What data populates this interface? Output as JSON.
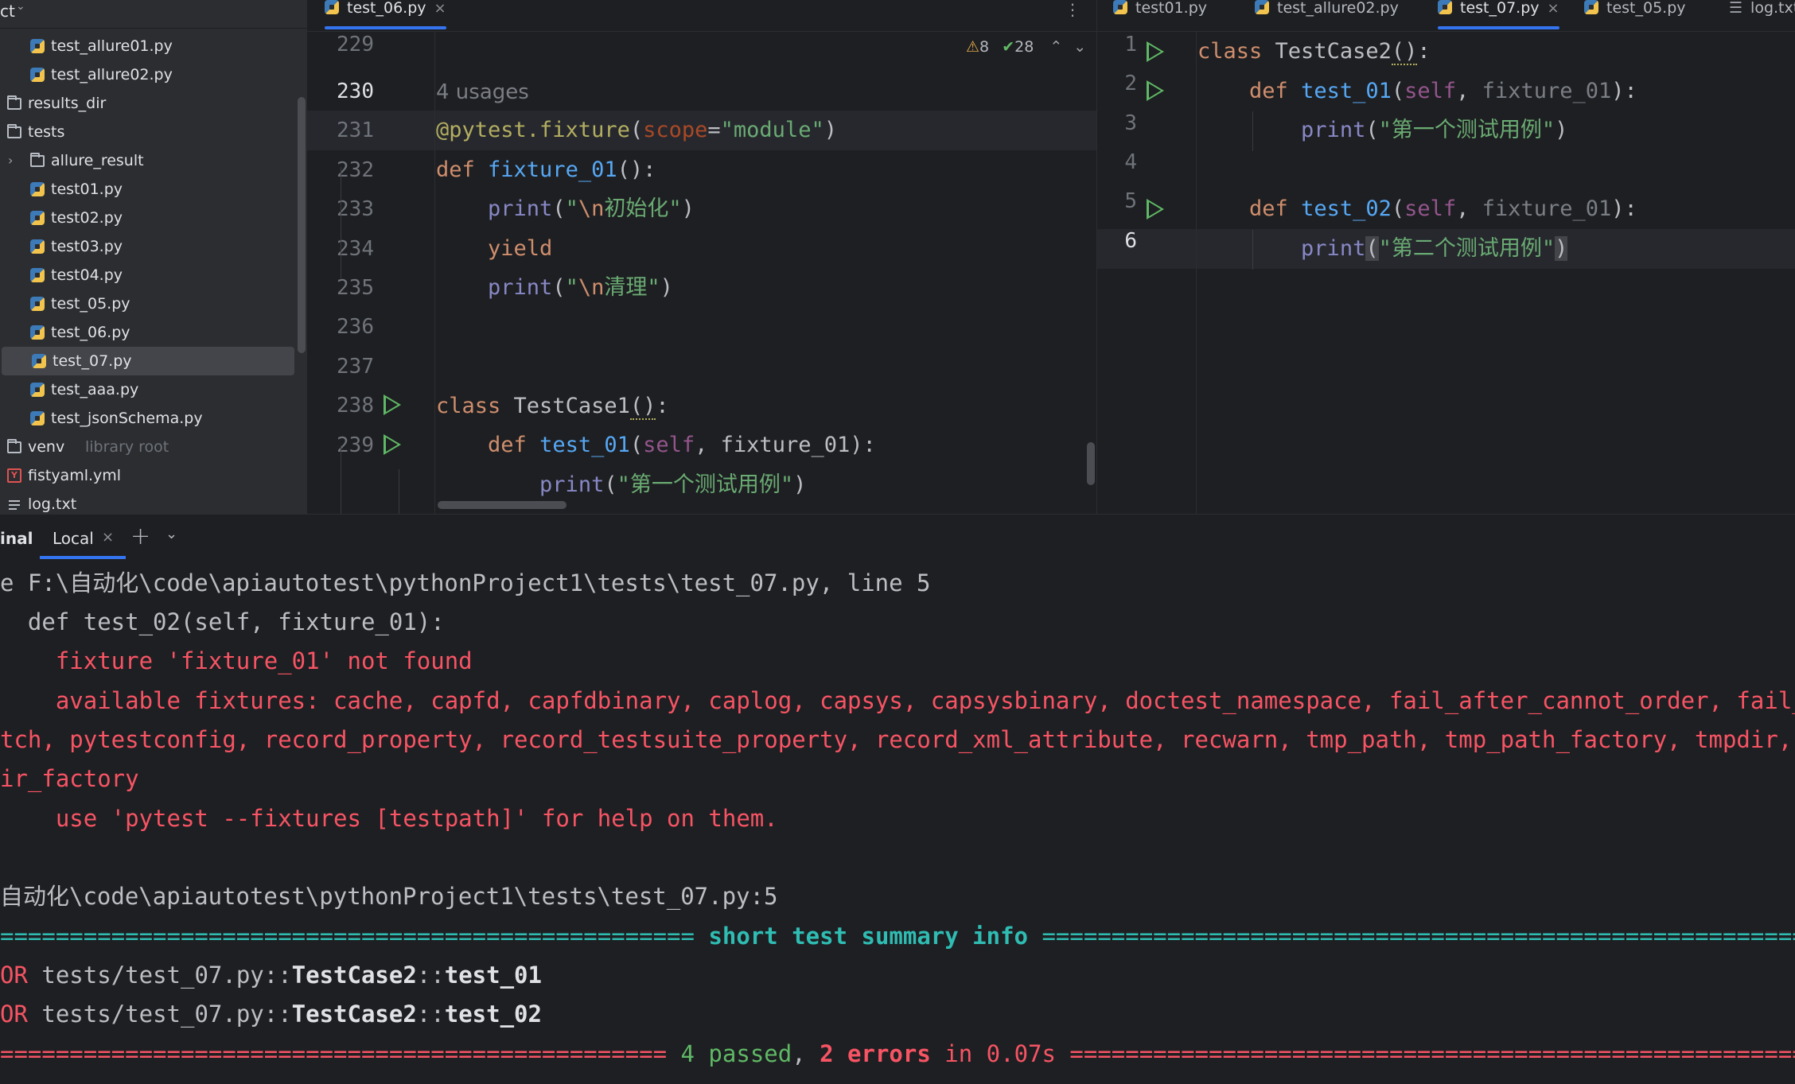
{
  "project_tree": {
    "header": "ct",
    "items": [
      {
        "label": "test_allure01.py",
        "type": "py",
        "indent": 2
      },
      {
        "label": "test_allure02.py",
        "type": "py",
        "indent": 2
      },
      {
        "label": "results_dir",
        "type": "folder",
        "indent": 1
      },
      {
        "label": "tests",
        "type": "folder",
        "indent": 1
      },
      {
        "label": "allure_result",
        "type": "folder",
        "indent": 2,
        "collapsed": true
      },
      {
        "label": "test01.py",
        "type": "py",
        "indent": 2
      },
      {
        "label": "test02.py",
        "type": "py",
        "indent": 2
      },
      {
        "label": "test03.py",
        "type": "py",
        "indent": 2
      },
      {
        "label": "test04.py",
        "type": "py",
        "indent": 2
      },
      {
        "label": "test_05.py",
        "type": "py",
        "indent": 2
      },
      {
        "label": "test_06.py",
        "type": "py",
        "indent": 2
      },
      {
        "label": "test_07.py",
        "type": "py",
        "indent": 2,
        "selected": true
      },
      {
        "label": "test_aaa.py",
        "type": "py",
        "indent": 2
      },
      {
        "label": "test_jsonSchema.py",
        "type": "py",
        "indent": 2
      },
      {
        "label": "venv",
        "type": "folder",
        "indent": 1,
        "hint": "library root"
      },
      {
        "label": "fistyaml.yml",
        "type": "yml",
        "indent": 1
      },
      {
        "label": "log.txt",
        "type": "txt",
        "indent": 1
      }
    ]
  },
  "left_editor": {
    "tab": {
      "label": "test_06.py",
      "close": "×"
    },
    "more_icon": "⋮",
    "inspections": {
      "warnings": "8",
      "ok": "28",
      "warn_glyph": "⚠",
      "ok_glyph": "✔",
      "up": "⌃",
      "down": "⌄"
    },
    "usages_hint": "4 usages",
    "line_numbers": [
      "229",
      "230",
      "231",
      "232",
      "233",
      "234",
      "235",
      "236",
      "237",
      "238",
      "239"
    ]
  },
  "right_editor": {
    "tabs": [
      {
        "label": "test01.py",
        "active": false
      },
      {
        "label": "test_allure02.py",
        "active": false
      },
      {
        "label": "test_07.py",
        "active": true,
        "close": "×"
      },
      {
        "label": "test_05.py",
        "active": false
      },
      {
        "label": "log.txt",
        "active": false
      }
    ],
    "line_numbers": [
      "1",
      "2",
      "3",
      "4",
      "5",
      "6"
    ]
  },
  "terminal": {
    "title": "inal",
    "tab_label": "Local",
    "tab_close": "×",
    "add_icon": "+",
    "dropdown_icon": "⌄",
    "lines": {
      "l1": "e F:\\自动化\\code\\apiautotest\\pythonProject1\\tests\\test_07.py, line 5",
      "l2": "  def test_02(self, fixture_01):",
      "l3": "    fixture 'fixture_01' not found",
      "l4": "    available fixtures: cache, capfd, capfdbinary, caplog, capsys, capsysbinary, doctest_namespace, fail_after_cannot_order, fail_after_p",
      "l5": "tch, pytestconfig, record_property, record_testsuite_property, record_xml_attribute, recwarn, tmp_path, tmp_path_factory, tmpdir, tmpd",
      "l6": "ir_factory",
      "l7": "    use 'pytest --fixtures [testpath]' for help on them.",
      "l8": "",
      "l9": "自动化\\code\\apiautotest\\pythonProject1\\tests\\test_07.py:5",
      "sum_left": "================================================== ",
      "sum_mid": "short test summary info",
      "sum_right": " ====================================================================",
      "e1_pre": "OR ",
      "e1_path": "tests/test_07.py::",
      "e1_cls": "TestCase2",
      "e1_sep": "::",
      "e1_fn": "test_01",
      "e2_pre": "OR ",
      "e2_path": "tests/test_07.py::",
      "e2_cls": "TestCase2",
      "e2_sep": "::",
      "e2_fn": "test_02",
      "res_left": "================================================ ",
      "res_passed": "4 passed",
      "res_comma": ", ",
      "res_errors": "2 errors",
      "res_time": " in 0.07s",
      "res_right": " ===================================================================="
    }
  },
  "colors": {
    "accent": "#3574f0",
    "error": "#f75464",
    "success": "#5fb865",
    "cyan": "#2fbcb3"
  }
}
